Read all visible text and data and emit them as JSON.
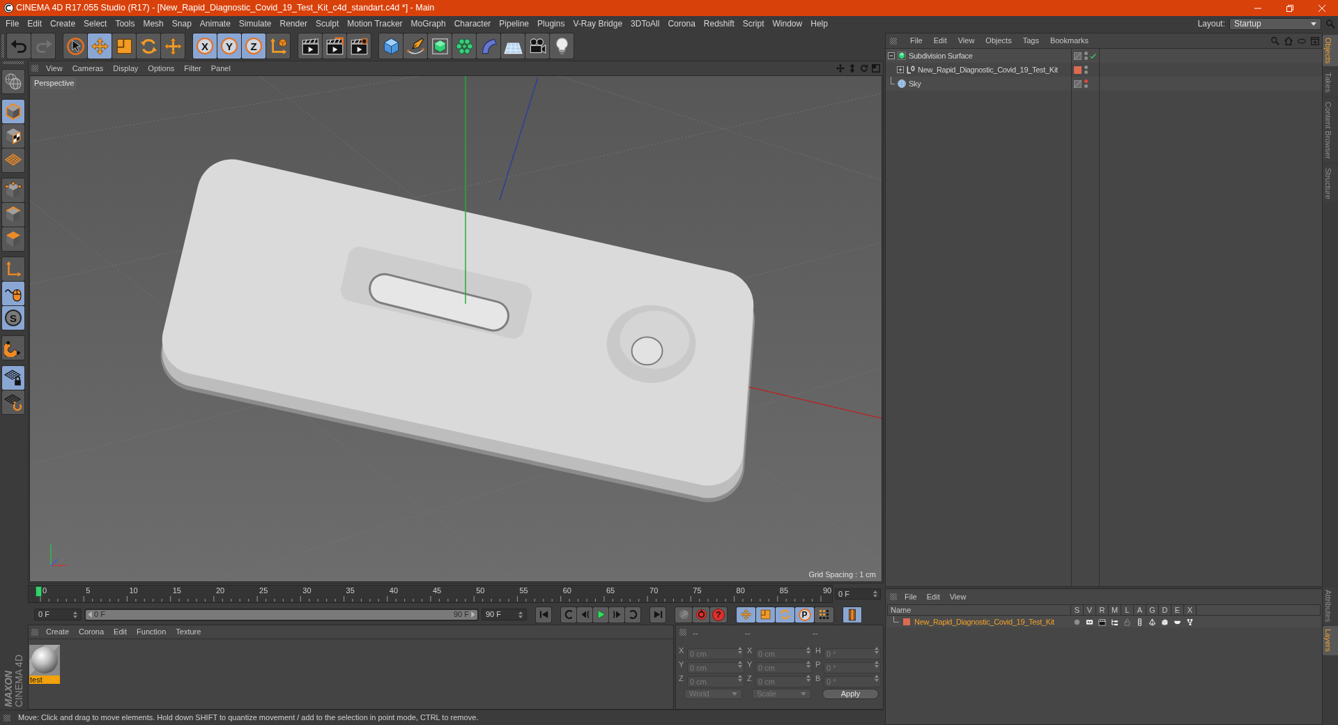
{
  "window": {
    "title": "CINEMA 4D R17.055 Studio (R17) - [New_Rapid_Diagnostic_Covid_19_Test_Kit_c4d_standart.c4d *] - Main"
  },
  "menu_bar": {
    "items": [
      "File",
      "Edit",
      "Create",
      "Select",
      "Tools",
      "Mesh",
      "Snap",
      "Animate",
      "Simulate",
      "Render",
      "Sculpt",
      "Motion Tracker",
      "MoGraph",
      "Character",
      "Pipeline",
      "Plugins",
      "V-Ray Bridge",
      "3DToAll",
      "Corona",
      "Redshift",
      "Script",
      "Window",
      "Help"
    ],
    "layout_label": "Layout:",
    "layout_value": "Startup"
  },
  "toolbar": {
    "groups": [
      [
        {
          "kind": "undo",
          "selected": false,
          "disabled": false
        },
        {
          "kind": "redo",
          "selected": false,
          "disabled": true
        }
      ],
      [
        {
          "kind": "select",
          "selected": false
        },
        {
          "kind": "move",
          "selected": true
        },
        {
          "kind": "scale",
          "selected": false
        },
        {
          "kind": "rotate",
          "selected": false
        },
        {
          "kind": "transform",
          "selected": false
        }
      ],
      [
        {
          "kind": "axis",
          "label": "X",
          "selected": true
        },
        {
          "kind": "axis",
          "label": "Y",
          "selected": true
        },
        {
          "kind": "axis",
          "label": "Z",
          "selected": true
        },
        {
          "kind": "coordsystem",
          "selected": false
        }
      ],
      [
        {
          "kind": "renderview",
          "selected": false
        },
        {
          "kind": "renderpicture",
          "selected": false
        },
        {
          "kind": "rendersettings",
          "selected": false
        }
      ],
      [
        {
          "kind": "cube",
          "selected": false
        },
        {
          "kind": "pen",
          "selected": false
        },
        {
          "kind": "subdivision",
          "selected": false
        },
        {
          "kind": "cloner",
          "selected": false
        },
        {
          "kind": "bend",
          "selected": false
        },
        {
          "kind": "floor",
          "selected": false
        },
        {
          "kind": "camera",
          "selected": false
        },
        {
          "kind": "light",
          "selected": false
        }
      ]
    ]
  },
  "tool_palette": {
    "groups": [
      [
        {
          "kind": "editable",
          "selected": false
        }
      ],
      [
        {
          "kind": "model",
          "selected": true
        },
        {
          "kind": "texture",
          "selected": false
        },
        {
          "kind": "workplane",
          "selected": false
        }
      ],
      [
        {
          "kind": "points",
          "selected": false
        },
        {
          "kind": "edges",
          "selected": false
        },
        {
          "kind": "polygons",
          "selected": false
        }
      ],
      [
        {
          "kind": "axis",
          "selected": false
        },
        {
          "kind": "tweak",
          "selected": true
        },
        {
          "kind": "solo",
          "label": "S",
          "selected": true
        }
      ],
      [
        {
          "kind": "snap",
          "selected": false
        }
      ],
      [
        {
          "kind": "planelock",
          "selected": true
        },
        {
          "kind": "planemode",
          "selected": false
        }
      ]
    ]
  },
  "logo": {
    "brand": "MAXON",
    "product": "CINEMA 4D"
  },
  "viewport": {
    "menu": [
      "View",
      "Cameras",
      "Display",
      "Options",
      "Filter",
      "Panel"
    ],
    "camera": "Perspective",
    "grid_spacing": "Grid Spacing : 1 cm"
  },
  "timeline": {
    "ticks": [
      "0",
      "5",
      "10",
      "15",
      "20",
      "25",
      "30",
      "35",
      "40",
      "45",
      "50",
      "55",
      "60",
      "65",
      "70",
      "75",
      "80",
      "85",
      "90"
    ],
    "level": 0,
    "current_frame": "0 F"
  },
  "transport": {
    "start_frame": "0 F",
    "range": {
      "start": "0 F",
      "end": "90 F",
      "level": 1
    },
    "end_frame": "90 F",
    "playback": [
      [
        {
          "kind": "first"
        }
      ],
      [
        {
          "kind": "prevkey"
        },
        {
          "kind": "prevframe"
        },
        {
          "kind": "play"
        },
        {
          "kind": "nextframe"
        },
        {
          "kind": "nextkey"
        }
      ],
      [
        {
          "kind": "last"
        }
      ]
    ],
    "keying": [
      {
        "kind": "record",
        "disabled": true
      },
      {
        "kind": "autokey",
        "disabled": false
      },
      {
        "kind": "keyselection",
        "label": "?",
        "disabled": false
      }
    ],
    "key_tracks": [
      {
        "kind": "position",
        "selected": true
      },
      {
        "kind": "scale",
        "selected": true
      },
      {
        "kind": "rotation",
        "selected": true
      },
      {
        "kind": "parameter",
        "label": "P",
        "selected": true
      },
      {
        "kind": "pla",
        "selected": false
      }
    ],
    "timeline_button": {
      "selected": true
    }
  },
  "materials": {
    "menu": [
      "Create",
      "Corona",
      "Edit",
      "Function",
      "Texture"
    ],
    "items": [
      {
        "name": "test",
        "selected": true
      }
    ]
  },
  "coordinates": {
    "headers": [
      "--",
      "--",
      "--"
    ],
    "rows": [
      [
        {
          "axis": "X",
          "value": "0 cm"
        },
        {
          "axis": "X",
          "value": "0 cm"
        },
        {
          "axis": "H",
          "value": "0 °"
        }
      ],
      [
        {
          "axis": "Y",
          "value": "0 cm"
        },
        {
          "axis": "Y",
          "value": "0 cm"
        },
        {
          "axis": "P",
          "value": "0 °"
        }
      ],
      [
        {
          "axis": "Z",
          "value": "0 cm"
        },
        {
          "axis": "Z",
          "value": "0 cm"
        },
        {
          "axis": "B",
          "value": "0 °"
        }
      ]
    ],
    "mode": "World",
    "size_mode": "Scale",
    "disabled": true,
    "apply": "Apply"
  },
  "status_bar": {
    "text": "Move: Click and drag to move elements. Hold down SHIFT to quantize movement / add to the selection in point mode, CTRL to remove."
  },
  "objects": {
    "menu": [
      "File",
      "Edit",
      "View",
      "Objects",
      "Tags",
      "Bookmarks"
    ],
    "items": [
      {
        "kind": "subdivision",
        "name": "Subdivision Surface",
        "selected": false,
        "expanded": true,
        "enabled": true,
        "editor_hidden": false,
        "render_hidden": false,
        "children": [
          {
            "kind": "null",
            "name": "New_Rapid_Diagnostic_Covid_19_Test_Kit",
            "selected": false,
            "expanded": false,
            "color": "#dc6a50",
            "editor_hidden": false,
            "render_hidden": false
          }
        ]
      },
      {
        "kind": "sky",
        "name": "Sky",
        "selected": false,
        "editor_hidden": true,
        "render_hidden": false
      }
    ]
  },
  "layers": {
    "menu": [
      "File",
      "Edit",
      "View"
    ],
    "columns": [
      "Name",
      "S",
      "V",
      "R",
      "M",
      "L",
      "A",
      "G",
      "D",
      "E",
      "X"
    ],
    "items": [
      {
        "name": "New_Rapid_Diagnostic_Covid_19_Test_Kit",
        "color": "#dc6a50",
        "selected": true,
        "flags": [
          {
            "kind": "solo",
            "on": false
          },
          {
            "kind": "visible",
            "on": true
          },
          {
            "kind": "render",
            "on": true
          },
          {
            "kind": "manager",
            "on": true
          },
          {
            "kind": "locked",
            "on": false
          },
          {
            "kind": "animation",
            "on": true
          },
          {
            "kind": "generators",
            "on": true
          },
          {
            "kind": "deformers",
            "on": true
          },
          {
            "kind": "expressions",
            "on": true
          },
          {
            "kind": "xrefs",
            "on": true
          }
        ]
      }
    ]
  },
  "side_tabs": {
    "top": [
      {
        "label": "Objects",
        "selected": true
      },
      {
        "label": "Takes",
        "selected": false
      },
      {
        "label": "Content Browser",
        "selected": false
      },
      {
        "label": "Structure",
        "selected": false
      }
    ],
    "bottom": [
      {
        "label": "Attributes",
        "selected": false
      },
      {
        "label": "Layers",
        "selected": true
      }
    ]
  }
}
